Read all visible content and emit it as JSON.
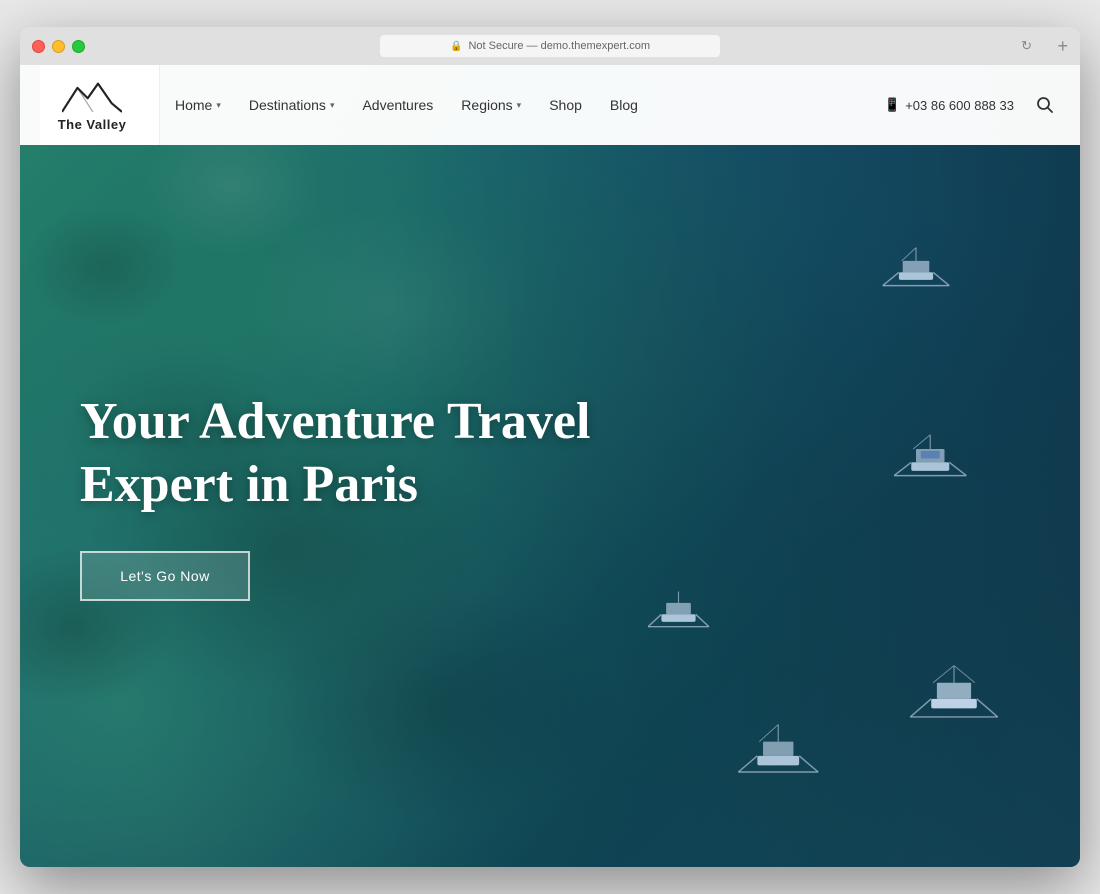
{
  "browser": {
    "titlebar_url": "Not Secure — demo.themexpert.com",
    "new_tab_label": "+"
  },
  "logo": {
    "name": "The Valley",
    "line1": "The",
    "line2": "Valley"
  },
  "nav": {
    "home_label": "Home",
    "destinations_label": "Destinations",
    "adventures_label": "Adventures",
    "regions_label": "Regions",
    "shop_label": "Shop",
    "blog_label": "Blog"
  },
  "contact": {
    "phone": "+03 86 600 888 33",
    "phone_icon": "📞"
  },
  "hero": {
    "title_line1": "Your Adventure Travel",
    "title_line2": "Expert in Paris",
    "cta_label": "Let's Go Now"
  },
  "colors": {
    "accent_teal": "#4a9c8a",
    "nav_bg": "rgba(255,255,255,0.97)",
    "hero_overlay": "rgba(30,80,70,0.4)"
  }
}
